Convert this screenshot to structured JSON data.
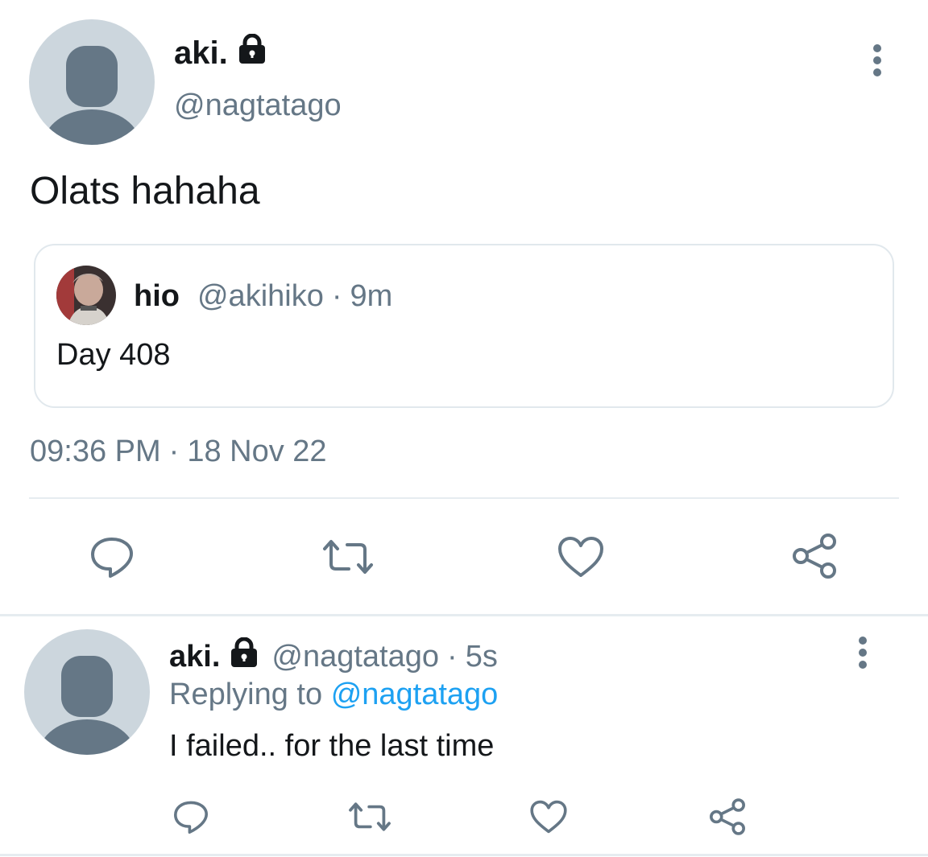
{
  "main_tweet": {
    "display_name": "aki.",
    "handle": "@nagtatago",
    "text": "Olats hahaha",
    "avatar_icon": "default-avatar-icon",
    "protected_icon": "lock-icon",
    "menu_icon": "more-vertical-icon",
    "quoted": {
      "display_name": "hio",
      "handle": "@akihiko",
      "separator": "·",
      "time": "9m",
      "text": "Day 408"
    },
    "timestamp": {
      "time": "09:36 PM",
      "separator": "·",
      "date": "18 Nov 22"
    },
    "actions": {
      "reply_icon": "reply-icon",
      "retweet_icon": "retweet-icon",
      "like_icon": "heart-icon",
      "share_icon": "share-icon"
    }
  },
  "reply_tweet": {
    "display_name": "aki.",
    "handle": "@nagtatago",
    "separator": "·",
    "time": "5s",
    "replying_to_label": "Replying to",
    "replying_to_handle": "@nagtatago",
    "text": "I failed.. for the last time"
  },
  "colors": {
    "text_primary": "#14171a",
    "text_secondary": "#657786",
    "link": "#1da1f2",
    "avatar_bg": "#ccd6dd",
    "avatar_fg": "#657786",
    "divider": "#e6ecf0"
  }
}
